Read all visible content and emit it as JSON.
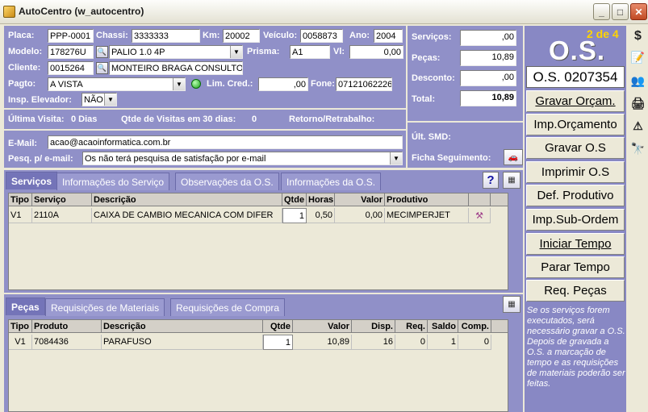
{
  "window": {
    "title": "AutoCentro (w_autocentro)"
  },
  "vehicle": {
    "placa_label": "Placa:",
    "placa": "PPP-0001",
    "chassi_label": "Chassi:",
    "chassi": "3333333",
    "km_label": "Km:",
    "km": "20002",
    "veiculo_label": "Veículo:",
    "veiculo": "0058873",
    "ano_label": "Ano:",
    "ano": "2004",
    "modelo_label": "Modelo:",
    "modelo_code": "178276U",
    "modelo_name": "PALIO 1.0 4P",
    "prisma_label": "Prisma:",
    "prisma": "A1",
    "vl_label": "Vl:",
    "vl": "0,00",
    "cliente_label": "Cliente:",
    "cliente_code": "0015264",
    "cliente_name": "MONTEIRO BRAGA CONSULTORIA",
    "pagto_label": "Pagto:",
    "pagto": "A VISTA",
    "limcred_label": "Lim. Cred.:",
    "limcred": ",00",
    "fone_label": "Fone:",
    "fone": "07121062226",
    "insp_label": "Insp. Elevador:",
    "insp": "NÃO"
  },
  "totals": {
    "servicos_label": "Serviços:",
    "servicos": ",00",
    "pecas_label": "Peças:",
    "pecas": "10,89",
    "desconto_label": "Desconto:",
    "desconto": ",00",
    "total_label": "Total:",
    "total": "10,89"
  },
  "visits": {
    "ultima_label": "Última Visita:",
    "ultima": "0 Dias",
    "qtde_label": "Qtde de Visitas em 30 dias:",
    "qtde": "0",
    "retorno_label": "Retorno/Retrabalho:"
  },
  "contact": {
    "email_label": "E-Mail:",
    "email": "acao@acaoinformatica.com.br",
    "pesq_label": "Pesq. p/ e-mail:",
    "pesq": "Os não terá pesquisa de satisfação por e-mail",
    "ult_smd_label": "Últ. SMD:",
    "ficha_label": "Ficha  Seguimento:"
  },
  "os": {
    "counter": "2 de 4",
    "big_label": "O.S.",
    "number": "O.S. 0207354"
  },
  "services_tabs": [
    "Serviços",
    "Informações do Serviço",
    "Observações da O.S.",
    "Informações da O.S."
  ],
  "services_grid": {
    "headers": [
      "Tipo",
      "Serviço",
      "Descrição",
      "Qtde",
      "Horas",
      "Valor",
      "Produtivo"
    ],
    "rows": [
      {
        "tipo": "V1",
        "servico": "2110A",
        "descricao": "CAIXA DE CAMBIO MECANICA COM DIFER",
        "qtde": "1",
        "horas": "0,50",
        "valor": "0,00",
        "produtivo": "MECIMPERJET"
      }
    ]
  },
  "parts_tabs": [
    "Peças",
    "Requisições de Materiais",
    "Requisições de Compra"
  ],
  "parts_grid": {
    "headers": [
      "Tipo",
      "Produto",
      "Descrição",
      "Qtde",
      "Valor",
      "Disp.",
      "Req.",
      "Saldo",
      "Comp."
    ],
    "rows": [
      {
        "tipo": "V1",
        "produto": "7084436",
        "descricao": "PARAFUSO",
        "qtde": "1",
        "valor": "10,89",
        "disp": "16",
        "req": "0",
        "saldo": "1",
        "comp": "0"
      }
    ]
  },
  "actions": {
    "gravar_orcam": "Gravar Orçam.",
    "imp_orcamento": "Imp.Orçamento",
    "gravar_os": "Gravar O.S",
    "imprimir_os": "Imprimir O.S",
    "def_produtivo": "Def. Produtivo",
    "imp_sub_ordem": "Imp.Sub-Ordem",
    "iniciar_tempo": "Iniciar Tempo",
    "parar_tempo": "Parar Tempo",
    "req_pecas": "Req. Peças"
  },
  "help_text": "Se os serviços forem executados, será necessário gravar a O.S. Depois de gravada a O.S. a marcação de tempo e as requisições de materiais poderão ser feitas.",
  "toolbar": {
    "dollar": "$",
    "binoculars": "🔭"
  },
  "colors": {
    "panel": "#9090c8",
    "tab_active": "#7474b8",
    "os_counter": "#ffd400"
  }
}
